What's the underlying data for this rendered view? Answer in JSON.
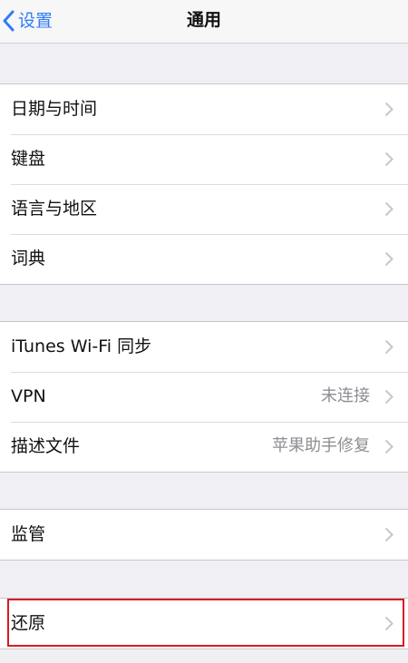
{
  "navbar": {
    "back_label": "设置",
    "title": "通用",
    "back_icon": "chevron-left-icon"
  },
  "groups": [
    {
      "rows": [
        {
          "label": "日期与时间",
          "value": ""
        },
        {
          "label": "键盘",
          "value": ""
        },
        {
          "label": "语言与地区",
          "value": ""
        },
        {
          "label": "词典",
          "value": ""
        }
      ]
    },
    {
      "rows": [
        {
          "label": "iTunes Wi-Fi 同步",
          "value": ""
        },
        {
          "label": "VPN",
          "value": "未连接"
        },
        {
          "label": "描述文件",
          "value": "苹果助手修复"
        }
      ]
    },
    {
      "rows": [
        {
          "label": "监管",
          "value": ""
        }
      ]
    },
    {
      "rows": [
        {
          "label": "还原",
          "value": ""
        }
      ]
    }
  ],
  "colors": {
    "accent": "#2f7cf6",
    "highlight": "#d41c24",
    "background": "#efeff4"
  },
  "icons": {
    "row_disclosure": "chevron-right-icon"
  }
}
